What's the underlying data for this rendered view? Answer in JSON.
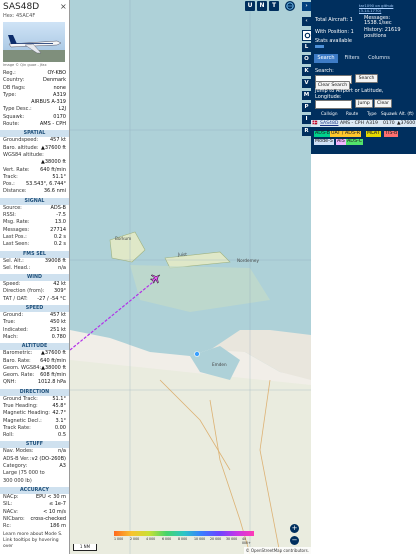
{
  "info": {
    "callsign": "SAS48D",
    "hex_label": "Hex: 45AC4F",
    "photo_credit": "Image © Qin guoe - Jfax",
    "general": [
      {
        "k": "Reg.:",
        "v": "OY-KBO"
      },
      {
        "k": "Country:",
        "v": "Denmark"
      },
      {
        "k": "DB flags:",
        "v": "none"
      },
      {
        "k": "Type:",
        "v": "A319"
      },
      {
        "k": "",
        "v": "AIRBUS A-319"
      },
      {
        "k": "Type Desc.:",
        "v": "L2J"
      },
      {
        "k": "Squawk:",
        "v": "0170"
      },
      {
        "k": "Route:",
        "v": "AMS - CPH"
      }
    ],
    "sections": [
      {
        "title": "SPATIAL",
        "rows": [
          {
            "k": "Groundspeed:",
            "v": "457 kt"
          },
          {
            "k": "Baro. altitude:",
            "v": "▲37600 ft"
          },
          {
            "k": "WGS84 altitude:",
            "v": ""
          },
          {
            "k": "",
            "v": "▲38000 ft"
          },
          {
            "k": "Vert. Rate:",
            "v": "640 ft/min"
          },
          {
            "k": "Track:",
            "v": "51.1°"
          },
          {
            "k": "Pos.:",
            "v": "53.543°, 6.744°"
          },
          {
            "k": "Distance:",
            "v": "36.6 nmi"
          }
        ]
      },
      {
        "title": "SIGNAL",
        "rows": [
          {
            "k": "Source:",
            "v": "ADS-B"
          },
          {
            "k": "RSSI:",
            "v": "-7.5"
          },
          {
            "k": "Msg. Rate:",
            "v": "13.0"
          },
          {
            "k": "Messages:",
            "v": "27714"
          },
          {
            "k": "Last Pos.:",
            "v": "0.2 s"
          },
          {
            "k": "Last Seen:",
            "v": "0.2 s"
          }
        ]
      },
      {
        "title": "FMS SEL",
        "rows": [
          {
            "k": "Sel. Alt.:",
            "v": "39008 ft"
          },
          {
            "k": "Sel. Head.:",
            "v": "n/a"
          }
        ]
      },
      {
        "title": "WIND",
        "rows": [
          {
            "k": "Speed:",
            "v": "42 kt"
          },
          {
            "k": "Direction (from):",
            "v": "309°"
          },
          {
            "k": "TAT / OAT:",
            "v": "-27 / -54 °C"
          }
        ]
      },
      {
        "title": "SPEED",
        "rows": [
          {
            "k": "Ground:",
            "v": "457 kt"
          },
          {
            "k": "True:",
            "v": "450 kt"
          },
          {
            "k": "Indicated:",
            "v": "251 kt"
          },
          {
            "k": "Mach:",
            "v": "0.780"
          }
        ]
      },
      {
        "title": "ALTITUDE",
        "rows": [
          {
            "k": "Barometric:",
            "v": "▲37600 ft"
          },
          {
            "k": "Baro. Rate:",
            "v": "640 ft/min"
          },
          {
            "k": "Geom. WGS84:",
            "v": "▲38000 ft"
          },
          {
            "k": "Geom. Rate:",
            "v": "608 ft/min"
          },
          {
            "k": "QNH:",
            "v": "1012.8 hPa"
          }
        ]
      },
      {
        "title": "DIRECTION",
        "rows": [
          {
            "k": "Ground Track:",
            "v": "51.1°"
          },
          {
            "k": "True Heading:",
            "v": "45.8°"
          },
          {
            "k": "Magnetic Heading:",
            "v": "42.7°"
          },
          {
            "k": "Magnetic Decl.:",
            "v": "3.1°"
          },
          {
            "k": "Track Rate:",
            "v": "0.00"
          },
          {
            "k": "Roll:",
            "v": "0.5"
          }
        ]
      },
      {
        "title": "STUFF",
        "rows": [
          {
            "k": "Nav. Modes:",
            "v": "n/a"
          },
          {
            "k": "ADS-B Ver.:",
            "v": "v2 (DO-260B)"
          },
          {
            "k": "Category:",
            "v": "A3"
          },
          {
            "k": "Large (75 000 to",
            "v": ""
          },
          {
            "k": "300 000 lb)",
            "v": ""
          }
        ]
      },
      {
        "title": "ACCURACY",
        "rows": [
          {
            "k": "NACp:",
            "v": "EPU < 30 m"
          },
          {
            "k": "SIL:",
            "v": "≤ 1e-7"
          },
          {
            "k": "NACv:",
            "v": "< 10 m/s"
          },
          {
            "k": "NICbaro:",
            "v": "cross-checked"
          },
          {
            "k": "Rc:",
            "v": "186 m"
          }
        ]
      }
    ],
    "footer": "Learn more about Mode S. Link tooltips by hovering over"
  },
  "map": {
    "top_buttons": [
      "U",
      "N",
      "T"
    ],
    "side_buttons": [
      "L",
      "O",
      "K",
      "V",
      "M",
      "P",
      "I",
      "R"
    ],
    "labels": [
      {
        "text": "Borkum",
        "kind": "town"
      },
      {
        "text": "Juist",
        "kind": "town"
      },
      {
        "text": "Emden",
        "kind": "town"
      },
      {
        "text": "Norderney",
        "kind": "town"
      }
    ],
    "scale_label": "1 NM",
    "altitude_scale": [
      "1 000",
      "2 000",
      "4 000",
      "6 000",
      "8 000",
      "10 000",
      "20 000",
      "30 000",
      "40 000+"
    ],
    "attribution": "© OpenStreetMap contributors.",
    "zoom_in": "+",
    "zoom_out": "−"
  },
  "right": {
    "link": "tar1090 on github (3.14.1770)",
    "total_aircraft_label": "Total Aircraft: 1",
    "with_position_label": "With Position: 1",
    "stats_label": "Stats available",
    "messages_label": "Messages:",
    "messages_value": "1538.1/sec",
    "history_label": "History: 21619 positions",
    "tabs": [
      "Search",
      "Filters",
      "Columns"
    ],
    "search_label": "Search:",
    "search_button": "Search",
    "clear_search_button": "Clear Search",
    "jump_label": "Jump to Airport or Latitude, Longitude:",
    "jump_button": "Jump",
    "clear_button": "Clear",
    "table_headers": [
      "Callsign",
      "Route",
      "Type",
      "Squawk",
      "Alt. (ft)"
    ],
    "table_row": {
      "flag": "🇩🇰",
      "callsign": "SAS48D",
      "route": "AMS - CPH",
      "type": "A319",
      "squawk": "0170",
      "alt": "▲37600"
    },
    "source_chips": [
      {
        "text": "ADS-B",
        "bg": "#00d08c"
      },
      {
        "text": "UAT / ADS-R",
        "bg": "#ffc72c"
      },
      {
        "text": "MLAT",
        "bg": "#e5d900"
      },
      {
        "text": "TIS-B",
        "bg": "#ff6f6f"
      },
      {
        "text": "Mode-S",
        "bg": "#cfe1f7"
      },
      {
        "text": "AIS",
        "bg": "#f2b5ff"
      },
      {
        "text": "ADS-C",
        "bg": "#52e46b"
      }
    ]
  }
}
